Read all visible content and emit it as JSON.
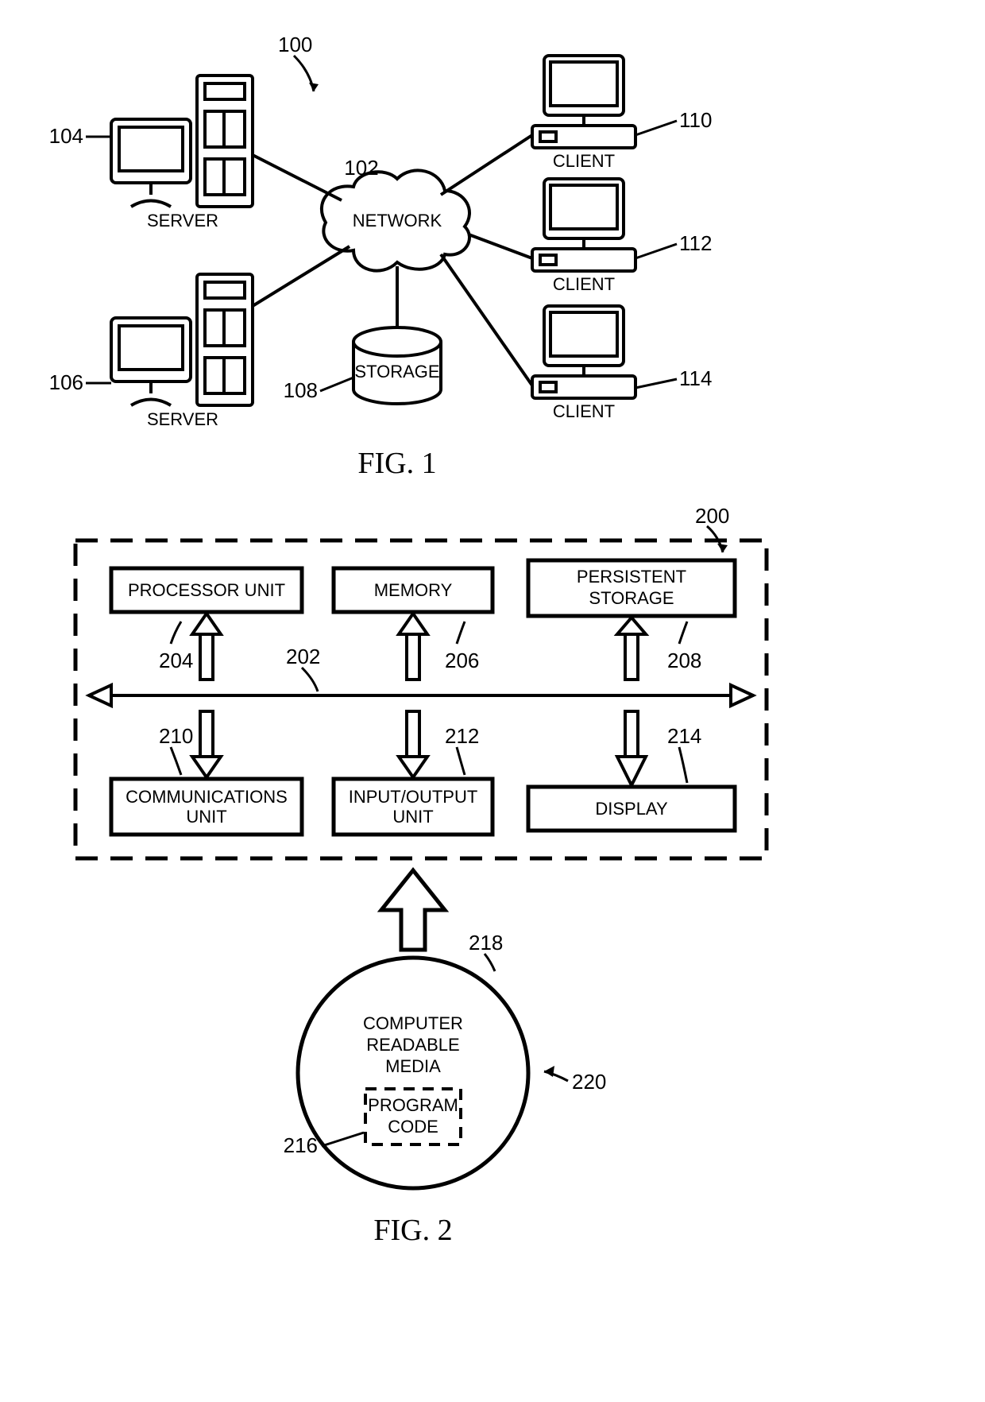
{
  "fig1": {
    "title": "FIG. 1",
    "refs": {
      "r100": "100",
      "r102": "102",
      "r104": "104",
      "r106": "106",
      "r108": "108",
      "r110": "110",
      "r112": "112",
      "r114": "114"
    },
    "labels": {
      "network": "NETWORK",
      "storage": "STORAGE",
      "server1": "SERVER",
      "server2": "SERVER",
      "client1": "CLIENT",
      "client2": "CLIENT",
      "client3": "CLIENT"
    }
  },
  "fig2": {
    "title": "FIG. 2",
    "refs": {
      "r200": "200",
      "r202": "202",
      "r204": "204",
      "r206": "206",
      "r208": "208",
      "r210": "210",
      "r212": "212",
      "r214": "214",
      "r216": "216",
      "r218": "218",
      "r220": "220"
    },
    "boxes": {
      "proc": "PROCESSOR UNIT",
      "mem": "MEMORY",
      "persist_l1": "PERSISTENT",
      "persist_l2": "STORAGE",
      "comm_l1": "COMMUNICATIONS",
      "comm_l2": "UNIT",
      "io_l1": "INPUT/OUTPUT",
      "io_l2": "UNIT",
      "disp": "DISPLAY",
      "media_l1": "COMPUTER",
      "media_l2": "READABLE",
      "media_l3": "MEDIA",
      "code_l1": "PROGRAM",
      "code_l2": "CODE"
    }
  }
}
